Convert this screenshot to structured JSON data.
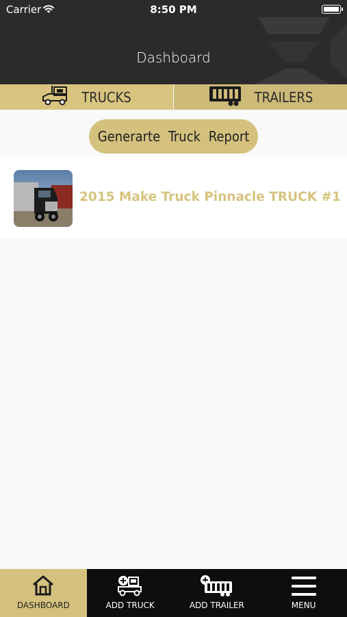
{
  "status_bar": {
    "carrier": "Carrier",
    "time": "8:50 PM"
  },
  "header": {
    "title": "Dashboard"
  },
  "tabs": [
    {
      "label": "TRUCKS",
      "icon": "truck-icon",
      "active": true
    },
    {
      "label": "TRAILERS",
      "icon": "trailer-icon",
      "active": false
    }
  ],
  "report_button": {
    "label": "Generarte Truck Report"
  },
  "trucks": [
    {
      "title": "2015 Make Truck Pinnacle TRUCK #1",
      "image": "truck-photo"
    }
  ],
  "bottom_nav": [
    {
      "label": "DASHBOARD",
      "icon": "home-icon",
      "active": true
    },
    {
      "label": "ADD TRUCK",
      "icon": "add-truck-icon",
      "active": false
    },
    {
      "label": "ADD TRAILER",
      "icon": "add-trailer-icon",
      "active": false
    },
    {
      "label": "MENU",
      "icon": "menu-icon",
      "active": false
    }
  ],
  "colors": {
    "accent": "#d4c17e",
    "header": "#2b2b2b",
    "nav": "#0e0e0e",
    "background": "#f9f9f9"
  }
}
